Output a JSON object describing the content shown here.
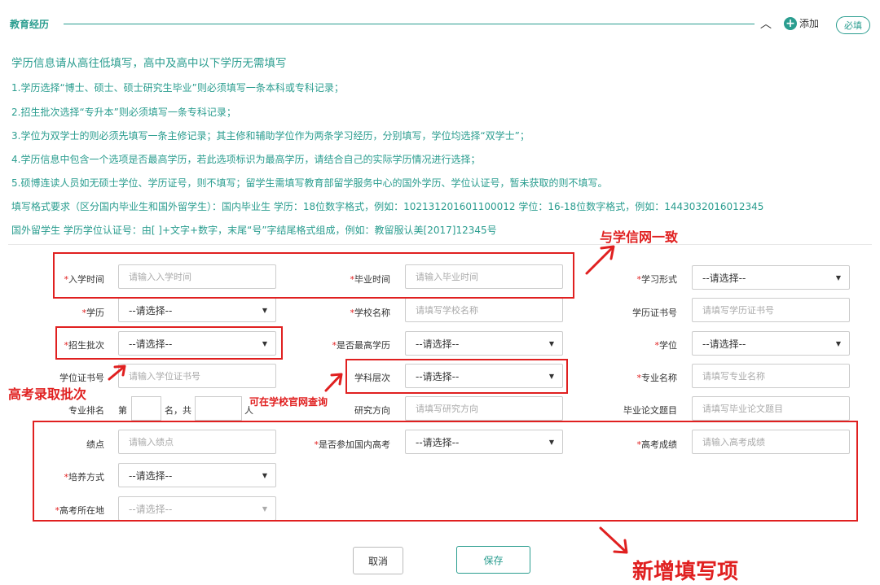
{
  "section": {
    "title": "教育经历",
    "add_label": "添加",
    "required_badge": "必填"
  },
  "notes": {
    "head": "学历信息请从高往低填写，高中及高中以下学历无需填写",
    "lines": [
      "1.学历选择“博士、硕士、硕士研究生毕业”则必须填写一条本科或专科记录；",
      "2.招生批次选择“专升本”则必须填写一条专科记录；",
      "3.学位为双学士的则必须先填写一条主修记录；其主修和辅助学位作为两条学习经历，分别填写，学位均选择“双学士”；",
      "4.学历信息中包含一个选项是否最高学历，若此选项标识为最高学历，请结合自己的实际学历情况进行选择；",
      "5.硕博连读人员如无硕士学位、学历证号，则不填写；留学生需填写教育部留学服务中心的国外学历、学位认证号，暂未获取的则不填写。",
      "填写格式要求（区分国内毕业生和国外留学生）：国内毕业生 学历：18位数字格式，例如：102131201601100012 学位：16-18位数字格式，例如：1443032016012345",
      "国外留学生 学历学位认证号：由[ ]+文字+数字，末尾“号”字结尾格式组成，例如：教留服认美[2017]12345号"
    ]
  },
  "form": {
    "admission_time": {
      "label": "入学时间",
      "placeholder": "请输入入学时间"
    },
    "graduation_time": {
      "label": "毕业时间",
      "placeholder": "请输入毕业时间"
    },
    "study_form": {
      "label": "学习形式",
      "value": "--请选择--"
    },
    "education": {
      "label": "学历",
      "value": "--请选择--"
    },
    "school_name": {
      "label": "学校名称",
      "placeholder": "请填写学校名称"
    },
    "education_cert": {
      "label": "学历证书号",
      "placeholder": "请填写学历证书号"
    },
    "enroll_batch": {
      "label": "招生批次",
      "value": "--请选择--"
    },
    "is_highest": {
      "label": "是否最高学历",
      "value": "--请选择--"
    },
    "degree": {
      "label": "学位",
      "value": "--请选择--"
    },
    "degree_cert": {
      "label": "学位证书号",
      "placeholder": "请输入学位证书号"
    },
    "subject_level": {
      "label": "学科层次",
      "value": "--请选择--"
    },
    "major_name": {
      "label": "专业名称",
      "placeholder": "请填写专业名称"
    },
    "major_rank": {
      "label": "专业排名",
      "prefix": "第",
      "mid": "名，共",
      "suffix": "人"
    },
    "research": {
      "label": "研究方向",
      "placeholder": "请填写研究方向"
    },
    "thesis": {
      "label": "毕业论文题目",
      "placeholder": "请填写毕业论文题目"
    },
    "gpa": {
      "label": "绩点",
      "placeholder": "请输入绩点"
    },
    "gaokao_joined": {
      "label": "是否参加国内高考",
      "value": "--请选择--"
    },
    "gaokao_score": {
      "label": "高考成绩",
      "placeholder": "请输入高考成绩"
    },
    "training_mode": {
      "label": "培养方式",
      "value": "--请选择--"
    },
    "gaokao_location": {
      "label": "高考所在地",
      "value": "--请选择--"
    }
  },
  "annotations": {
    "xuexin": "与学信网一致",
    "gaokao_batch": "高考录取批次",
    "school_site": "可在学校官网查询",
    "new_items": "新增填写项"
  },
  "buttons": {
    "cancel": "取消",
    "save": "保存"
  },
  "colors": {
    "accent": "#2a9d8f",
    "annotation": "#e02020",
    "required_star": "#e02020"
  }
}
